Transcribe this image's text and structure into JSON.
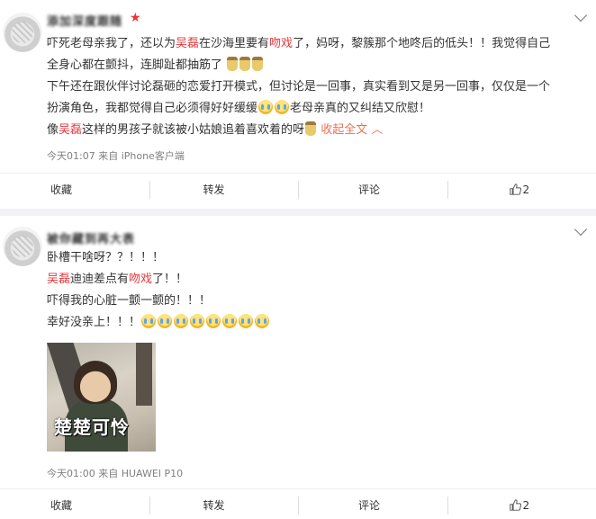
{
  "posts": [
    {
      "username": "添加深度跟随",
      "text": {
        "l1a": "吓死老母亲我了，还以为",
        "l1b": "吴磊",
        "l1c": "在沙海里要有",
        "l1d": "吻戏",
        "l1e": "了，妈呀，黎簇那个地咚后的低头！！我觉得自己",
        "l2": "全身心都在颤抖，连脚趾都抽筋了",
        "l3": "下午还在跟伙伴讨论磊砸的恋爱打开模式，但讨论是一回事，真实看到又是另一回事，仅仅是一个",
        "l4a": "扮演角色，我都觉得自己必须得好好缓缓",
        "l4b": "老母亲真的又纠结又欣慰！",
        "l5a": "像",
        "l5b": "吴磊",
        "l5c": "这样的男孩子就该被小姑娘追着喜欢着的呀",
        "collapse": "收起全文"
      },
      "meta": "今天01:07 来自 iPhone客户端",
      "actions": {
        "fav": "收藏",
        "repost": "转发",
        "comment": "评论",
        "likes": "2"
      }
    },
    {
      "username": "被你藏到再大表",
      "text": {
        "l1": "卧槽干啥呀？？！！！",
        "l2a": "吴磊",
        "l2b": "迪迪差点有",
        "l2c": "吻戏",
        "l2d": "了！！",
        "l3": "吓得我的心脏一颤一颤的！！！",
        "l4": "幸好没亲上！！！"
      },
      "image_caption": "楚楚可怜",
      "meta": "今天01:00 来自 HUAWEI P10",
      "actions": {
        "fav": "收藏",
        "repost": "转发",
        "comment": "评论",
        "likes": "2"
      }
    }
  ],
  "icons": {
    "vip": "star-icon",
    "menu": "chevron-down-icon",
    "like": "thumbs-up-icon",
    "emoji_cry": "crying-emoji-icon",
    "emoji_bottle": "bottle-emoji-icon"
  },
  "colors": {
    "highlight": "#e4393c",
    "link": "#eb7350",
    "meta": "#808080"
  }
}
